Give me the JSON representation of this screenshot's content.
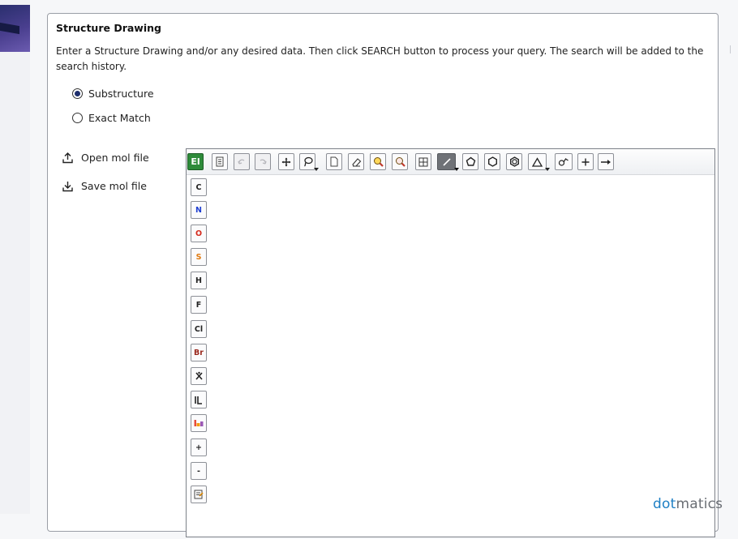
{
  "panel": {
    "title": "Structure Drawing",
    "description": "Enter a Structure Drawing and/or any desired data. Then click SEARCH button to process your query. The search will be added to the search history."
  },
  "search_mode": {
    "options": [
      {
        "label": "Substructure",
        "selected": true
      },
      {
        "label": "Exact Match",
        "selected": false
      }
    ]
  },
  "file_actions": {
    "open_label": "Open mol file",
    "save_label": "Save mol file"
  },
  "editor": {
    "top_toolbar": [
      {
        "icon": "element-table-icon",
        "label": "El"
      },
      {
        "icon": "document-icon"
      },
      {
        "icon": "undo-icon"
      },
      {
        "icon": "redo-icon"
      },
      {
        "icon": "move-icon"
      },
      {
        "icon": "lasso-select-icon"
      },
      {
        "icon": "new-page-icon"
      },
      {
        "icon": "eraser-icon"
      },
      {
        "icon": "zoom-in-icon"
      },
      {
        "icon": "zoom-out-icon"
      },
      {
        "icon": "template-grid-icon"
      },
      {
        "icon": "single-bond-icon"
      },
      {
        "icon": "pentagon-ring-icon"
      },
      {
        "icon": "hexagon-ring-icon"
      },
      {
        "icon": "benzene-ring-icon"
      },
      {
        "icon": "triangle-ring-icon"
      },
      {
        "icon": "chain-tool-icon"
      },
      {
        "icon": "plus-icon"
      },
      {
        "icon": "arrow-right-icon"
      }
    ],
    "atom_toolbar": [
      {
        "label": "C",
        "color": "#222222"
      },
      {
        "label": "N",
        "color": "#1f3fd1"
      },
      {
        "label": "O",
        "color": "#d52b1e"
      },
      {
        "label": "S",
        "color": "#e07a10"
      },
      {
        "label": "H",
        "color": "#222222"
      },
      {
        "label": "F",
        "color": "#222222"
      },
      {
        "label": "Cl",
        "color": "#222222"
      },
      {
        "label": "Br",
        "color": "#9b2a1f"
      },
      {
        "icon": "x-atom-icon"
      },
      {
        "icon": "label-atom-icon"
      },
      {
        "icon": "periodic-table-icon"
      },
      {
        "label": "+",
        "color": "#222222"
      },
      {
        "label": "-",
        "color": "#222222"
      },
      {
        "icon": "properties-icon"
      }
    ],
    "brand_prefix": "dot",
    "brand_suffix": "matics",
    "colors": {
      "element_button": "#2e8b3a",
      "brand_blue": "#1d7fc4",
      "brand_gray": "#6a6e74"
    }
  }
}
